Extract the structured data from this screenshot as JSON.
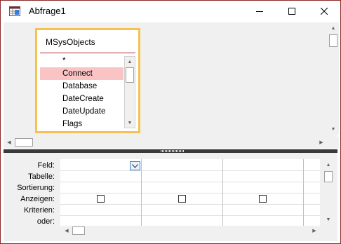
{
  "window": {
    "title": "Abfrage1",
    "icons": {
      "app": "query-datasheet-icon",
      "minimize": "minimize-icon",
      "maximize": "maximize-icon",
      "close": "close-icon"
    }
  },
  "table_pane": {
    "field_list": {
      "table_name": "MSysObjects",
      "fields": [
        "*",
        "Connect",
        "Database",
        "DateCreate",
        "DateUpdate",
        "Flags"
      ],
      "selected_field": "Connect"
    }
  },
  "design_grid": {
    "row_labels": [
      "Feld:",
      "Tabelle:",
      "Sortierung:",
      "Anzeigen:",
      "Kriterien:",
      "oder:"
    ],
    "column_count": 3,
    "show_checked": [
      false,
      false,
      false
    ]
  },
  "colors": {
    "selection": "#fbc4c4",
    "field_list_border": "#f5c252",
    "window_border": "#8a2a2a"
  }
}
